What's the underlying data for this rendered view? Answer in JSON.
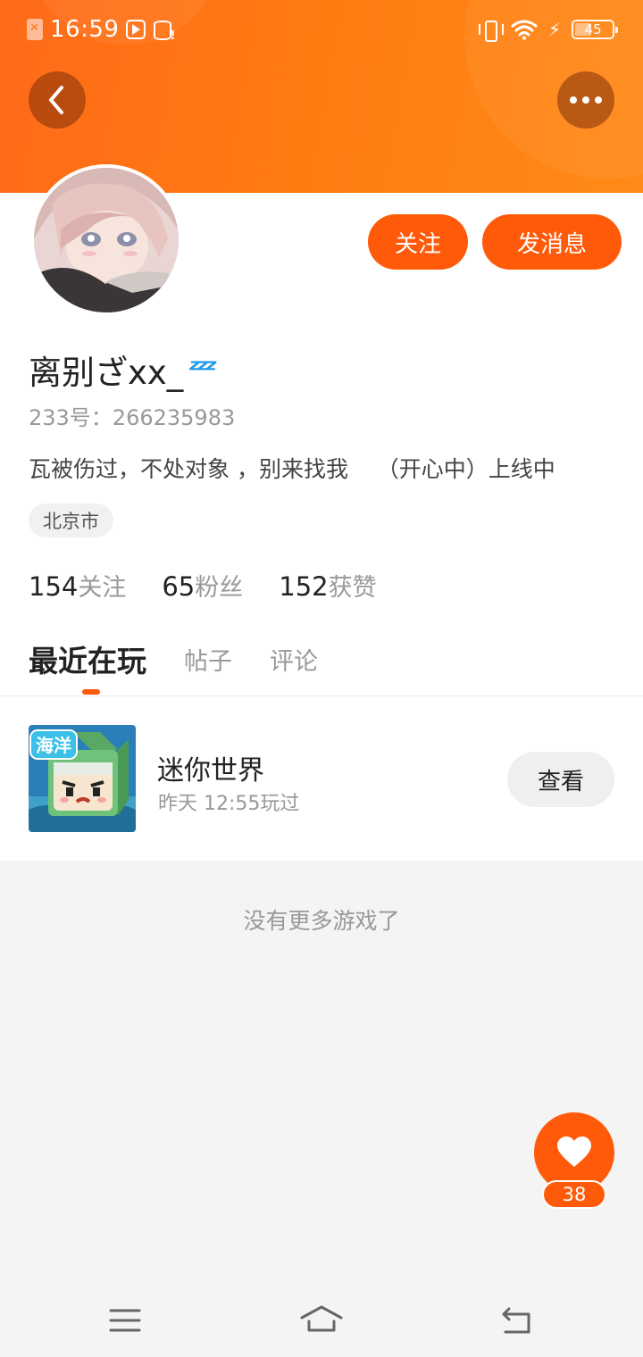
{
  "status_bar": {
    "time": "16:59",
    "battery": "45",
    "battery_level": 0.45
  },
  "profile": {
    "username": "离别ざxx_",
    "status_emoji_icon": "zzz-sleep-icon",
    "user_id_line": "233号：266235983",
    "bio": "瓦被伤过，不处对象 ，别来找我    （开心中）上线中",
    "location": "北京市",
    "follow_label": "关注",
    "message_label": "发消息"
  },
  "stats": [
    {
      "value": "154",
      "label": "关注"
    },
    {
      "value": "65",
      "label": "粉丝"
    },
    {
      "value": "152",
      "label": "获赞"
    }
  ],
  "tabs": [
    {
      "label": "最近在玩",
      "active": true
    },
    {
      "label": "帖子",
      "active": false
    },
    {
      "label": "评论",
      "active": false
    }
  ],
  "games": [
    {
      "thumb_text": "海洋",
      "name": "迷你世界",
      "last_played": "昨天 12:55玩过",
      "action_label": "查看"
    }
  ],
  "empty_message": "没有更多游戏了",
  "like_count": "38",
  "colors": {
    "accent": "#ff5a0a",
    "header_gradient_start": "#ff6a1a",
    "header_gradient_end": "#ff8a18"
  }
}
